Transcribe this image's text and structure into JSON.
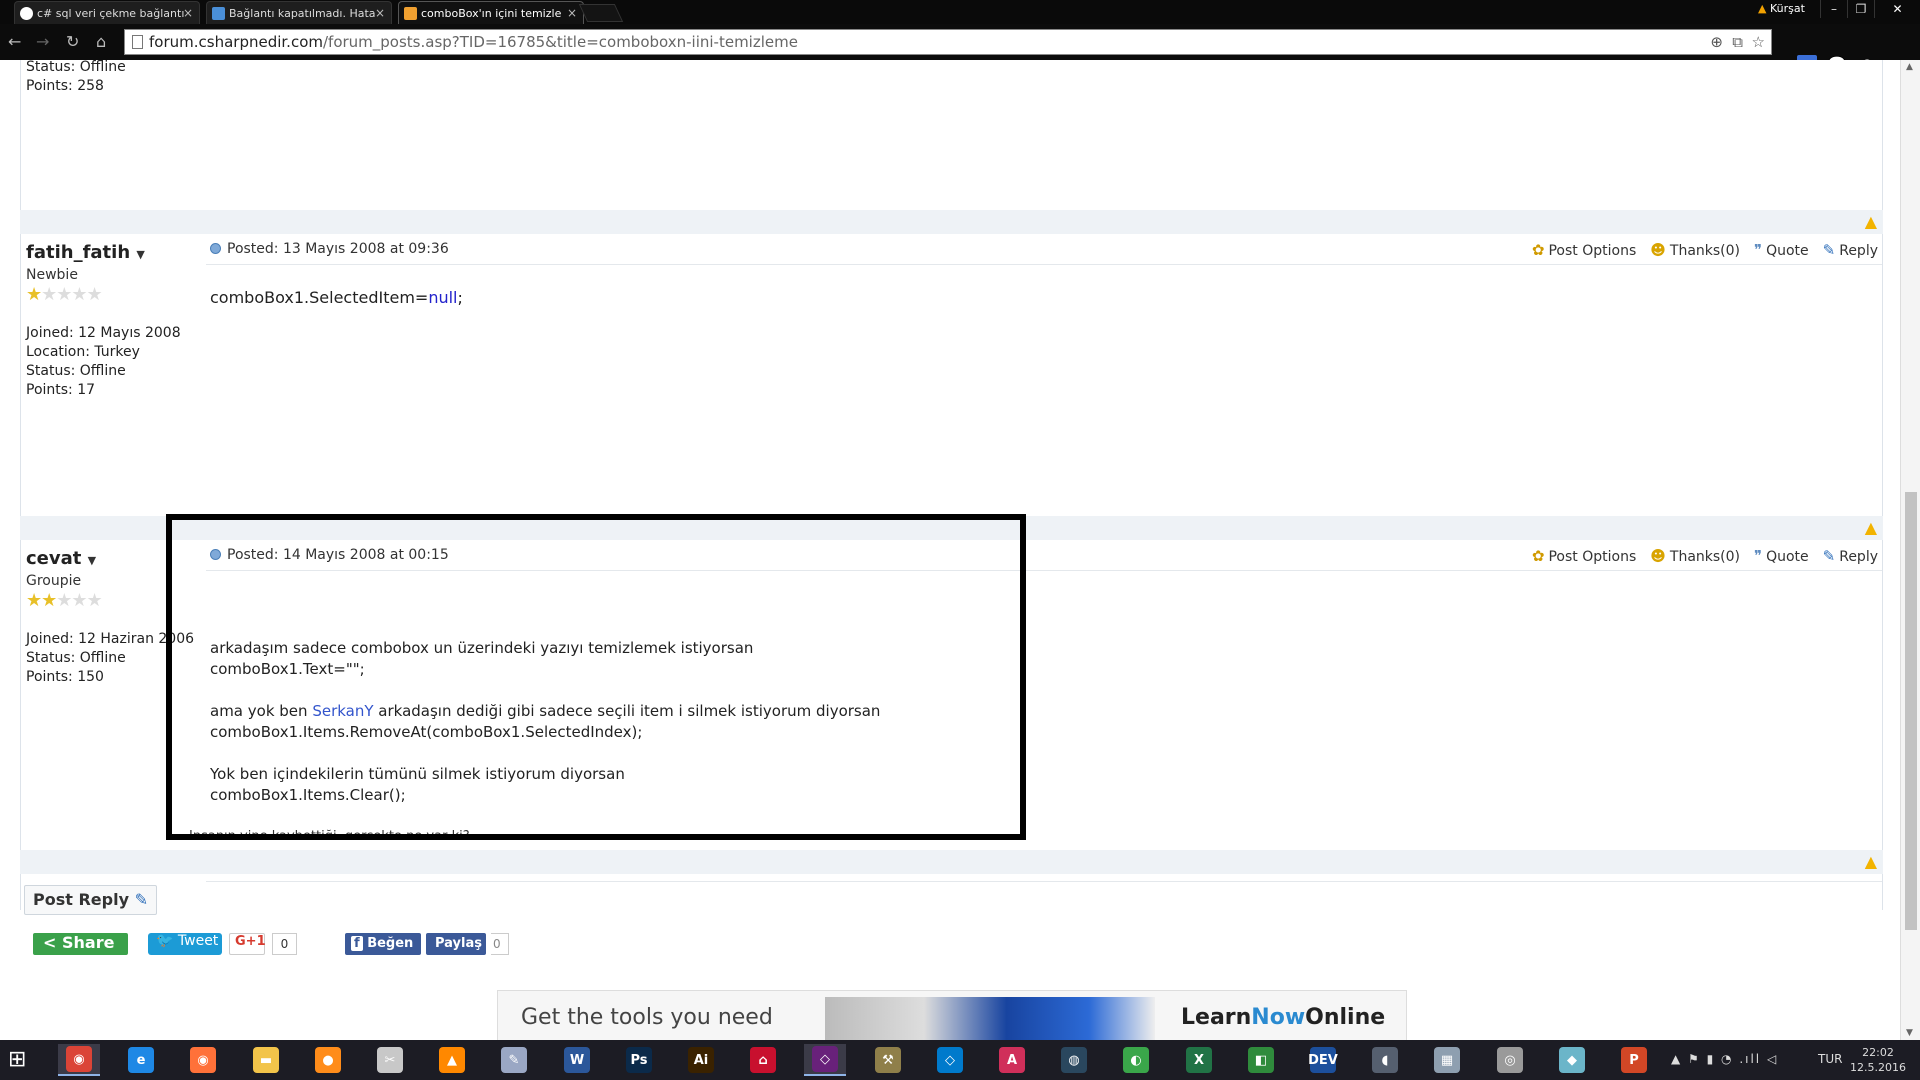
{
  "browser": {
    "tabs": [
      {
        "label": "c# sql veri çekme bağlantı",
        "favicon_color": "#ffffff"
      },
      {
        "label": "Bağlantı kapatılmadı. Hata",
        "favicon_color": "#4a8fd8"
      },
      {
        "label": "comboBox'ın içini temizle",
        "favicon_color": "#f0a030"
      }
    ],
    "tab_close": "×",
    "user_name": "Kürşat",
    "url_domain": "forum.csharpnedir.com",
    "url_path": "/forum_posts.asp?TID=16785&title=comboboxn-iini-temizleme",
    "window_buttons": [
      "–",
      "❐",
      "✕"
    ]
  },
  "posts": [
    {
      "status": "Status: Offline",
      "points": "Points: 258"
    },
    {
      "username": "fatih_fatih",
      "rank": "Newbie",
      "stars_filled": 1,
      "stars_total": 5,
      "info": [
        "Joined: 12 Mayıs 2008",
        "Location: Turkey",
        "Status: Offline",
        "Points: 17"
      ],
      "posted": "Posted: 13 Mayıs 2008 at 09:36",
      "code_prefix": "comboBox1.SelectedItem=",
      "code_keyword": "null",
      "code_suffix": ";"
    },
    {
      "username": "cevat",
      "rank": "Groupie",
      "stars_filled": 2,
      "stars_total": 5,
      "info": [
        "Joined: 12 Haziran 2006",
        "Status: Offline",
        "Points: 150"
      ],
      "posted": "Posted: 14 Mayıs 2008 at 00:15",
      "line1": "arkadaşım sadece combobox un üzerindeki yazıyı temizlemek istiyorsan",
      "line2": "comboBox1.Text=\"\";",
      "line3_pre": "ama yok ben ",
      "line3_link": "SerkanY",
      "line3_post": " arkadaşın dediği gibi sadece seçili item i silmek istiyorum diyorsan",
      "line4": "comboBox1.Items.RemoveAt(comboBox1.SelectedIndex);",
      "line5": "Yok ben içindekilerin tümünü silmek istiyorum diyorsan",
      "line6": "comboBox1.Items.Clear();",
      "signature": "İnsanın yine kaybettiği, gerçekte ne var ki?"
    }
  ],
  "post_actions": {
    "options": "Post Options",
    "thanks": "Thanks(0)",
    "quote": "Quote",
    "reply": "Reply"
  },
  "post_reply_label": "Post Reply",
  "share": {
    "share": "Share",
    "tweet": "Tweet",
    "gplus": "G+1",
    "gplus_count": "0",
    "like": "Beğen",
    "share_fb": "Paylaş",
    "fb_count": "0"
  },
  "ad": {
    "headline": "Get the tools you need",
    "logo_a": "Learn",
    "logo_b": "Now",
    "logo_c": "Online"
  },
  "taskbar": {
    "apps": [
      {
        "glyph": "◉",
        "color": "#db4437"
      },
      {
        "glyph": "e",
        "color": "#1e88e5"
      },
      {
        "glyph": "◉",
        "color": "#ff7139"
      },
      {
        "glyph": "▬",
        "color": "#f2c44a"
      },
      {
        "glyph": "●",
        "color": "#ff8c1a"
      },
      {
        "glyph": "✂",
        "color": "#c8c8c8"
      },
      {
        "glyph": "▲",
        "color": "#ff8800"
      },
      {
        "glyph": "✎",
        "color": "#9aa7c4"
      },
      {
        "glyph": "W",
        "color": "#2b579a"
      },
      {
        "glyph": "Ps",
        "color": "#0b2a4a"
      },
      {
        "glyph": "Ai",
        "color": "#3a2200"
      },
      {
        "glyph": "⌂",
        "color": "#c8102e"
      },
      {
        "glyph": "◇",
        "color": "#68217a"
      },
      {
        "glyph": "⚒",
        "color": "#8f7f4a"
      },
      {
        "glyph": "◇",
        "color": "#007acc"
      },
      {
        "glyph": "A",
        "color": "#d02f5a"
      },
      {
        "glyph": "◍",
        "color": "#2a475e"
      },
      {
        "glyph": "◐",
        "color": "#3aa64a"
      },
      {
        "glyph": "X",
        "color": "#217346"
      },
      {
        "glyph": "◧",
        "color": "#2f8b3c"
      },
      {
        "glyph": "DEV",
        "color": "#1c4f9c"
      },
      {
        "glyph": "◖",
        "color": "#555f6f"
      },
      {
        "glyph": "▦",
        "color": "#8e9fb0"
      },
      {
        "glyph": "◎",
        "color": "#9a9a9a"
      },
      {
        "glyph": "◆",
        "color": "#6bb5c9"
      },
      {
        "glyph": "P",
        "color": "#d24726"
      }
    ],
    "tray_icons": "▲  ⚑  ▮  ◔  .ıll  ◁",
    "lang": "TUR",
    "time": "22:02",
    "date": "12.5.2016"
  }
}
